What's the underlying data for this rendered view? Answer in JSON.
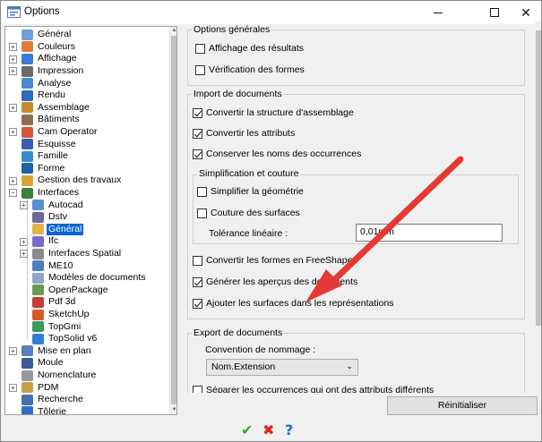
{
  "window": {
    "title": "Options"
  },
  "tree": {
    "items": [
      {
        "label": "Général",
        "depth": 0,
        "expander": "none",
        "icon": "#6fa0d8",
        "selected": false
      },
      {
        "label": "Couleurs",
        "depth": 0,
        "expander": "plus",
        "icon": "#e07b39",
        "selected": false
      },
      {
        "label": "Affichage",
        "depth": 0,
        "expander": "plus",
        "icon": "#3a7bd5",
        "selected": false
      },
      {
        "label": "Impression",
        "depth": 0,
        "expander": "plus",
        "icon": "#6a6a6a",
        "selected": false
      },
      {
        "label": "Analyse",
        "depth": 0,
        "expander": "none",
        "icon": "#4a8bd0",
        "selected": false
      },
      {
        "label": "Rendu",
        "depth": 0,
        "expander": "none",
        "icon": "#2e6bb8",
        "selected": false
      },
      {
        "label": "Assemblage",
        "depth": 0,
        "expander": "plus",
        "icon": "#c68a2e",
        "selected": false
      },
      {
        "label": "Bâtiments",
        "depth": 0,
        "expander": "none",
        "icon": "#8d6e4f",
        "selected": false
      },
      {
        "label": "Cam Operator",
        "depth": 0,
        "expander": "plus",
        "icon": "#d4553a",
        "selected": false
      },
      {
        "label": "Esquisse",
        "depth": 0,
        "expander": "none",
        "icon": "#3b5fb0",
        "selected": false
      },
      {
        "label": "Famille",
        "depth": 0,
        "expander": "none",
        "icon": "#3a8ad0",
        "selected": false
      },
      {
        "label": "Forme",
        "depth": 0,
        "expander": "none",
        "icon": "#1f5fa8",
        "selected": false
      },
      {
        "label": "Gestion des travaux",
        "depth": 0,
        "expander": "plus",
        "icon": "#d9a53a",
        "selected": false
      },
      {
        "label": "Interfaces",
        "depth": 0,
        "expander": "minus",
        "icon": "#3f7f3f",
        "selected": false
      },
      {
        "label": "Autocad",
        "depth": 1,
        "expander": "plus",
        "icon": "#5a8fd0",
        "selected": false
      },
      {
        "label": "Dstv",
        "depth": 1,
        "expander": "none",
        "icon": "#6a6a9a",
        "selected": false
      },
      {
        "label": "Général",
        "depth": 1,
        "expander": "none",
        "icon": "#e2b34a",
        "selected": true
      },
      {
        "label": "Ifc",
        "depth": 1,
        "expander": "plus",
        "icon": "#7a6ac8",
        "selected": false
      },
      {
        "label": "Interfaces Spatial",
        "depth": 1,
        "expander": "plus",
        "icon": "#8a8a8a",
        "selected": false
      },
      {
        "label": "ME10",
        "depth": 1,
        "expander": "none",
        "icon": "#4f7fbf",
        "selected": false
      },
      {
        "label": "Modèles de documents",
        "depth": 1,
        "expander": "none",
        "icon": "#8fa8c8",
        "selected": false
      },
      {
        "label": "OpenPackage",
        "depth": 1,
        "expander": "none",
        "icon": "#6b9a4f",
        "selected": false
      },
      {
        "label": "Pdf 3d",
        "depth": 1,
        "expander": "none",
        "icon": "#c83a3a",
        "selected": false
      },
      {
        "label": "SketchUp",
        "depth": 1,
        "expander": "none",
        "icon": "#d85a2a",
        "selected": false
      },
      {
        "label": "TopGmi",
        "depth": 1,
        "expander": "none",
        "icon": "#3a9a5a",
        "selected": false
      },
      {
        "label": "TopSolid v6",
        "depth": 1,
        "expander": "none",
        "icon": "#2f7fd8",
        "selected": false
      },
      {
        "label": "Mise en plan",
        "depth": 0,
        "expander": "plus",
        "icon": "#5a7fc0",
        "selected": false
      },
      {
        "label": "Moule",
        "depth": 0,
        "expander": "none",
        "icon": "#3a5a9a",
        "selected": false
      },
      {
        "label": "Nomenclature",
        "depth": 0,
        "expander": "none",
        "icon": "#9a9a9a",
        "selected": false
      },
      {
        "label": "PDM",
        "depth": 0,
        "expander": "plus",
        "icon": "#c8a04a",
        "selected": false
      },
      {
        "label": "Recherche",
        "depth": 0,
        "expander": "none",
        "icon": "#4a6fb0",
        "selected": false
      },
      {
        "label": "Tôlerie",
        "depth": 0,
        "expander": "none",
        "icon": "#2f6fc8",
        "selected": false
      }
    ]
  },
  "options_generales": {
    "title": "Options générales",
    "affichage_resultats": {
      "label": "Affichage des résultats",
      "checked": false
    },
    "verification_formes": {
      "label": "Vérification des formes",
      "checked": false
    }
  },
  "import": {
    "title": "Import de documents",
    "convertir_structure": {
      "label": "Convertir la structure d'assemblage",
      "checked": true
    },
    "convertir_attributs": {
      "label": "Convertir les attributs",
      "checked": true
    },
    "conserver_noms": {
      "label": "Conserver les noms des occurrences",
      "checked": true
    },
    "simplification": {
      "title": "Simplification et couture",
      "simplifier": {
        "label": "Simplifier la géométrie",
        "checked": false
      },
      "couture": {
        "label": "Couture des surfaces",
        "checked": false
      },
      "tolerance_label": "Tolérance linéaire :",
      "tolerance_value": "0,01mm"
    },
    "convertir_freeshape": {
      "label": "Convertir les formes en FreeShape",
      "checked": false
    },
    "generer_apercus": {
      "label": "Générer les aperçus des documents",
      "checked": true
    },
    "ajouter_surfaces": {
      "label": "Ajouter les surfaces dans les représentations",
      "checked": true
    }
  },
  "export": {
    "title": "Export de documents",
    "convention_label": "Convention de nommage :",
    "convention_value": "Nom.Extension",
    "separer": {
      "label": "Séparer les occurrences qui ont des attributs différents",
      "checked": false
    }
  },
  "buttons": {
    "reset": "Réinitialiser"
  },
  "colors": {
    "selection": "#0a64d6",
    "annotation_arrow": "#e53935",
    "ok": "#2bb02b",
    "cancel": "#e02424",
    "help": "#1f6fcf"
  }
}
